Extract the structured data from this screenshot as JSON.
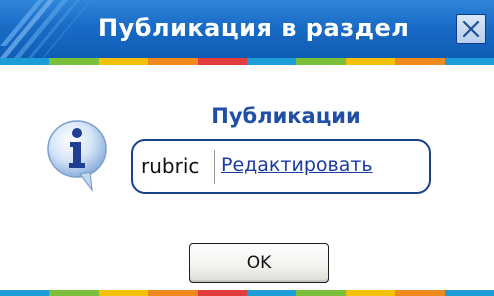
{
  "dialog": {
    "title": "Публикация в раздел",
    "close_icon": "close-icon"
  },
  "content": {
    "icon": "info-icon",
    "section_title": "Публикации",
    "rubric": {
      "name": "rubric",
      "edit_label": "Редактировать"
    }
  },
  "buttons": {
    "ok_label": "OK"
  },
  "colors": {
    "title_bar": "#1a6cc7",
    "accent_text": "#1f4fa6",
    "link": "#1a3aa8",
    "box_border": "#17408d",
    "strip": [
      "#1c9dd8",
      "#7bbf3a",
      "#f4c20d",
      "#f08a1c",
      "#e23c3c",
      "#1c9dd8",
      "#7bbf3a",
      "#f4c20d",
      "#f08a1c",
      "#1c9dd8"
    ]
  }
}
